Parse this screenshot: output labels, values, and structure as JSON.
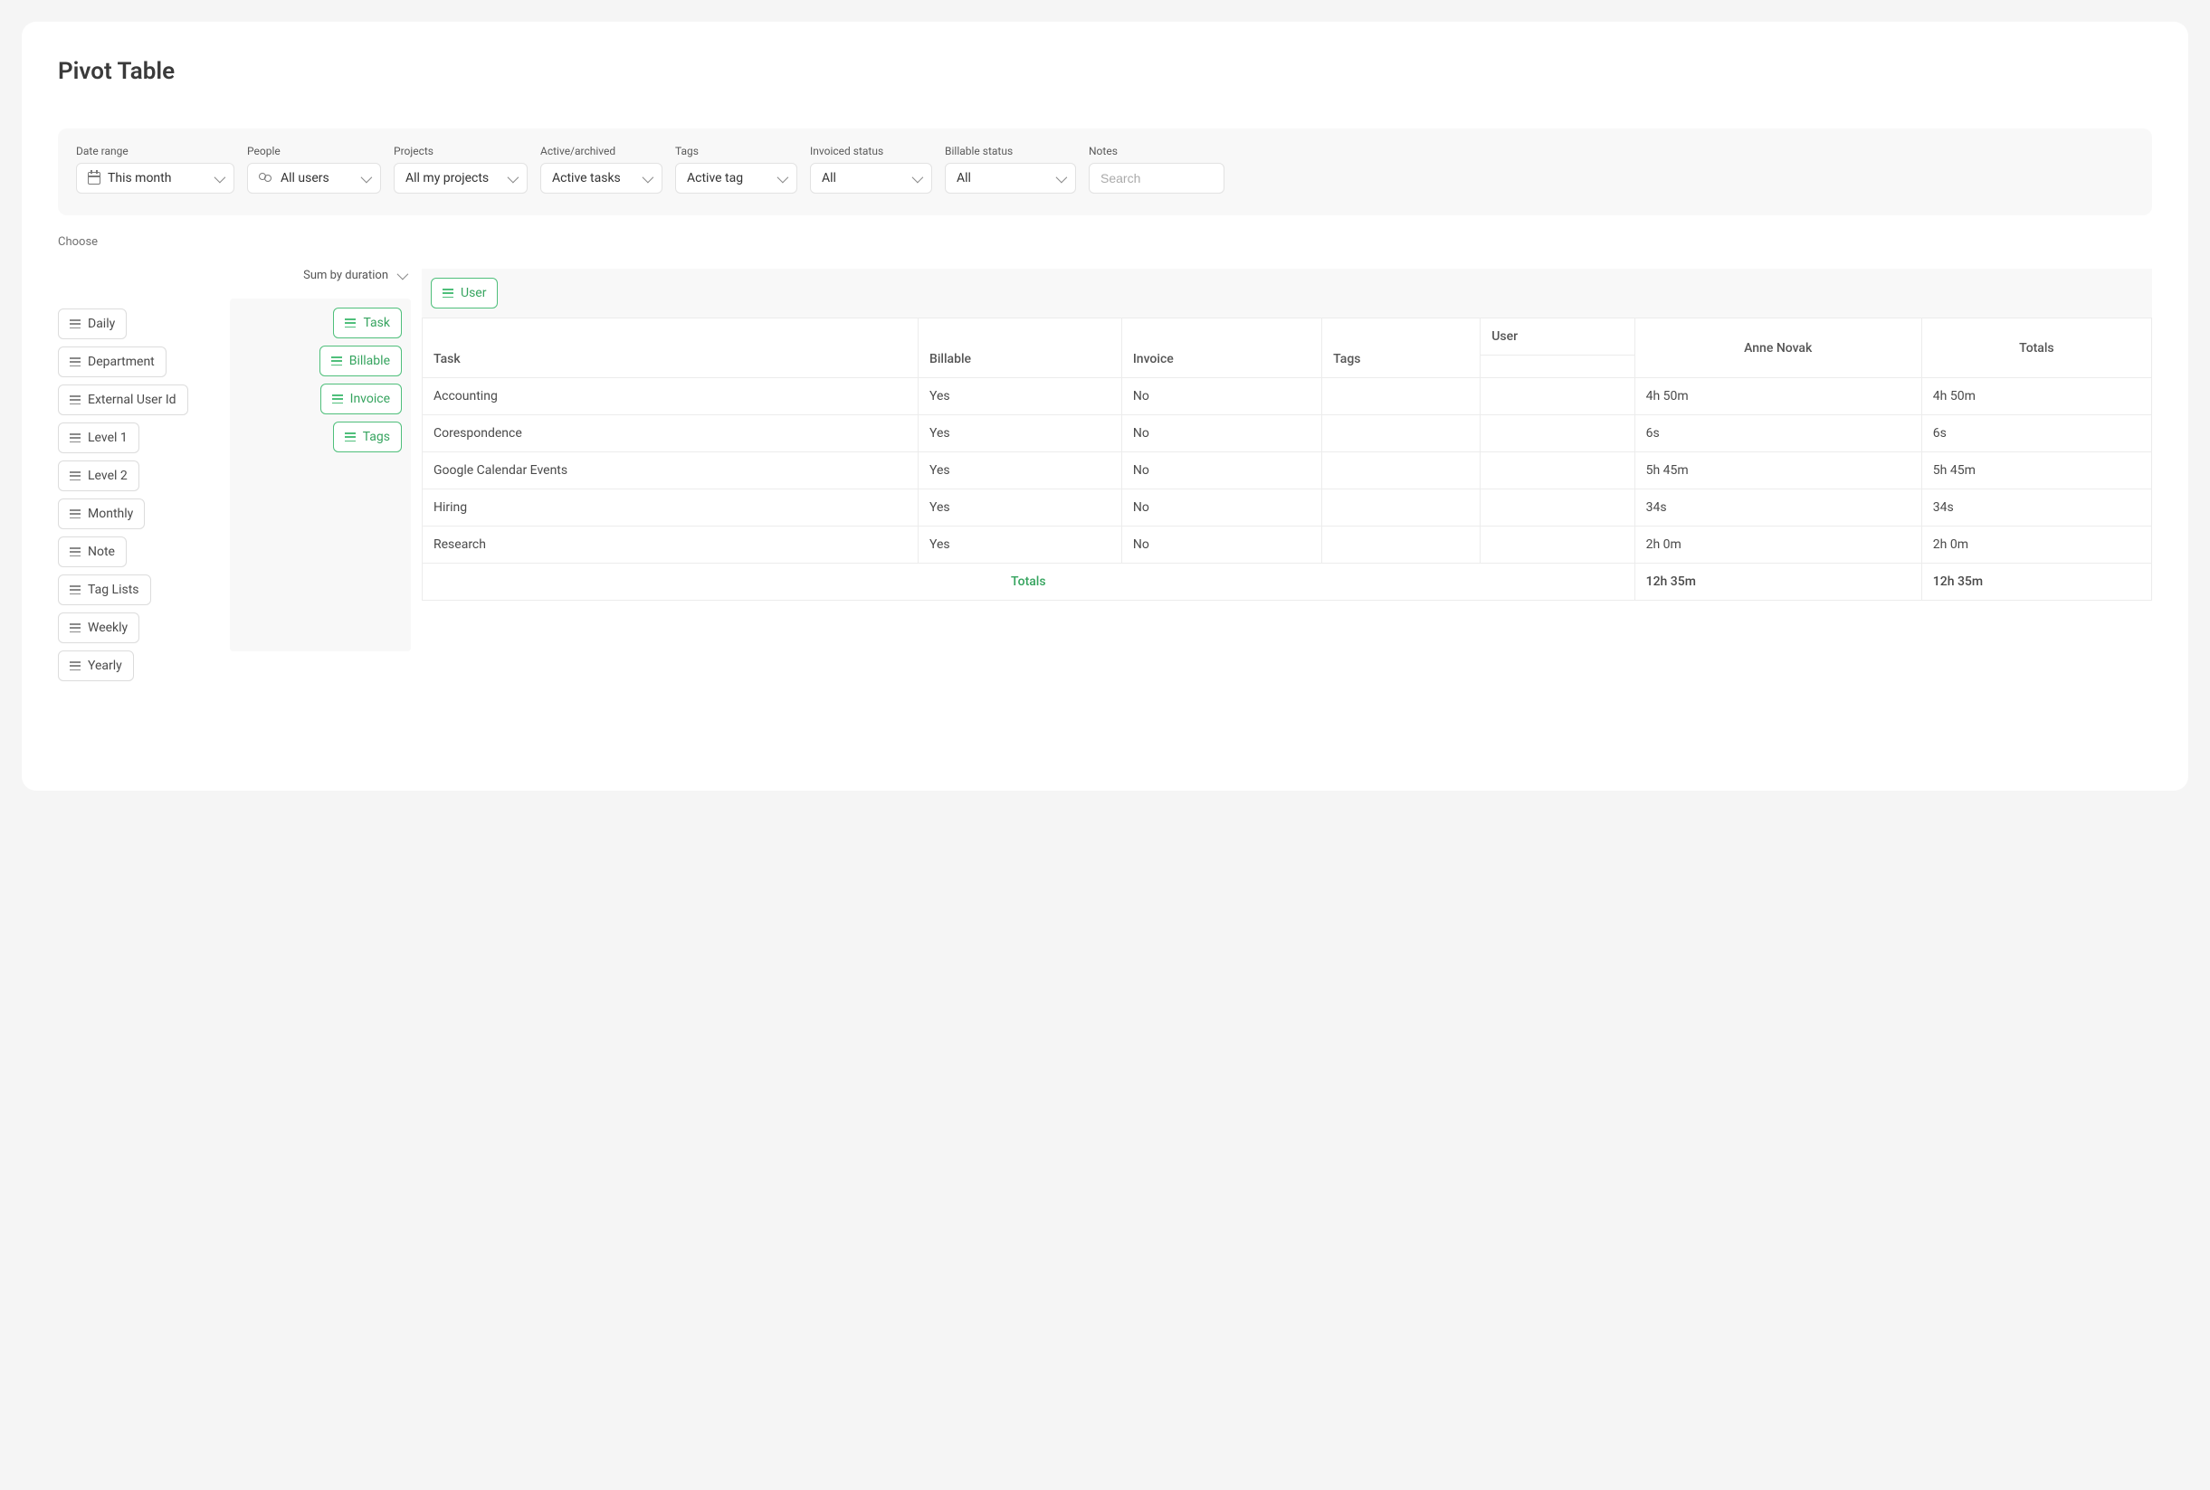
{
  "page": {
    "title": "Pivot Table"
  },
  "filters": {
    "date_range": {
      "label": "Date range",
      "value": "This month"
    },
    "people": {
      "label": "People",
      "value": "All users"
    },
    "projects": {
      "label": "Projects",
      "value": "All my projects"
    },
    "active": {
      "label": "Active/archived",
      "value": "Active tasks"
    },
    "tags": {
      "label": "Tags",
      "value": "Active tag"
    },
    "invoiced": {
      "label": "Invoiced status",
      "value": "All"
    },
    "billable": {
      "label": "Billable status",
      "value": "All"
    },
    "notes": {
      "label": "Notes",
      "placeholder": "Search"
    }
  },
  "choose": {
    "label": "Choose",
    "available": [
      "Daily",
      "Department",
      "External User Id",
      "Level 1",
      "Level 2",
      "Monthly",
      "Note",
      "Tag Lists",
      "Weekly",
      "Yearly"
    ],
    "sum_by_label": "Sum by duration",
    "row_dims": [
      "Task",
      "Billable",
      "Invoice",
      "Tags"
    ],
    "col_dims": [
      "User"
    ]
  },
  "table": {
    "col_group_label": "User",
    "row_headers": [
      "Task",
      "Billable",
      "Invoice",
      "Tags"
    ],
    "col_user": "Anne Novak",
    "totals_label": "Totals",
    "rows": [
      {
        "task": "Accounting",
        "billable": "Yes",
        "invoice": "No",
        "tags": "",
        "value": "4h 50m",
        "total": "4h 50m"
      },
      {
        "task": "Corespondence",
        "billable": "Yes",
        "invoice": "No",
        "tags": "",
        "value": "6s",
        "total": "6s"
      },
      {
        "task": "Google Calendar Events",
        "billable": "Yes",
        "invoice": "No",
        "tags": "",
        "value": "5h 45m",
        "total": "5h 45m"
      },
      {
        "task": "Hiring",
        "billable": "Yes",
        "invoice": "No",
        "tags": "",
        "value": "34s",
        "total": "34s"
      },
      {
        "task": "Research",
        "billable": "Yes",
        "invoice": "No",
        "tags": "",
        "value": "2h 0m",
        "total": "2h 0m"
      }
    ],
    "footer": {
      "label": "Totals",
      "value": "12h 35m",
      "grand": "12h 35m"
    }
  }
}
